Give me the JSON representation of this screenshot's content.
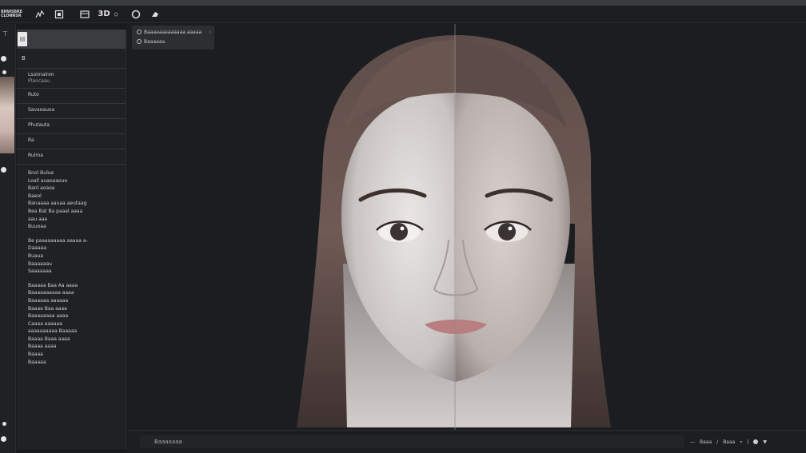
{
  "toolbar": {
    "logo_line1": "BNWSBRE",
    "logo_line2": "CLONNSR",
    "buttons": [
      {
        "name": "brush-tool-button",
        "icon": "brush-icon"
      },
      {
        "name": "frame-tool-button",
        "icon": "frame-icon"
      },
      {
        "name": "panel-toggle-button",
        "icon": "panel-icon"
      },
      {
        "name": "3d-view-button",
        "icon": "3d-icon",
        "label": "3D"
      },
      {
        "name": "render-button",
        "icon": "circle-icon"
      },
      {
        "name": "settings-button",
        "icon": "gear-icon"
      }
    ]
  },
  "rail": {
    "glyph": "⊤"
  },
  "panel": {
    "search_placeholder": "",
    "header": "B",
    "rows": [
      {
        "label": "Lsoimalnm",
        "sub": "Plancaau"
      },
      {
        "label": "Ruto",
        "sub": ""
      },
      {
        "label": "Savaeauoa",
        "sub": ""
      },
      {
        "label": "Phutauta",
        "sub": ""
      },
      {
        "label": "Ra",
        "sub": ""
      },
      {
        "label": "Rulma",
        "sub": ""
      }
    ],
    "text_block_1": [
      "Bnol Bulue",
      "Loall auaoaaouo",
      "Banl aoaoa",
      "Baeol",
      "Banaaaa aauaa aeutaag",
      "Bea Bat Ba paaal aaaa",
      "aau aaa",
      "Buuoaa"
    ],
    "text_block_2": [
      "Be paaaaaaaaa aaaaa a-",
      "Daaaaa",
      "Buaua",
      "Baaaaaau",
      "Saaaaaaa"
    ],
    "text_block_3": [
      "Baaaaa Baa Aa aaaa",
      "Baaaaaaaaaa aaaa",
      "Baaaaaa aaaaaa",
      "Baaaa Baa aaaa",
      "Baaaaaaaa aaaa",
      "Caaaa aaaaaa",
      "aaaaaaaaaa Baaaaa",
      "Baaaa Baaa aaaa",
      "Baaaa aaaa",
      "Baaaa",
      "Baaaaa"
    ]
  },
  "popup": {
    "line1": "Baaaaaaaaaaaaa aaaaa",
    "line2": "Baaaaaa"
  },
  "bottombar": {
    "status": "Baaaaaaa",
    "ctrl1": "Baaa",
    "ctrl2": "Baaa"
  }
}
